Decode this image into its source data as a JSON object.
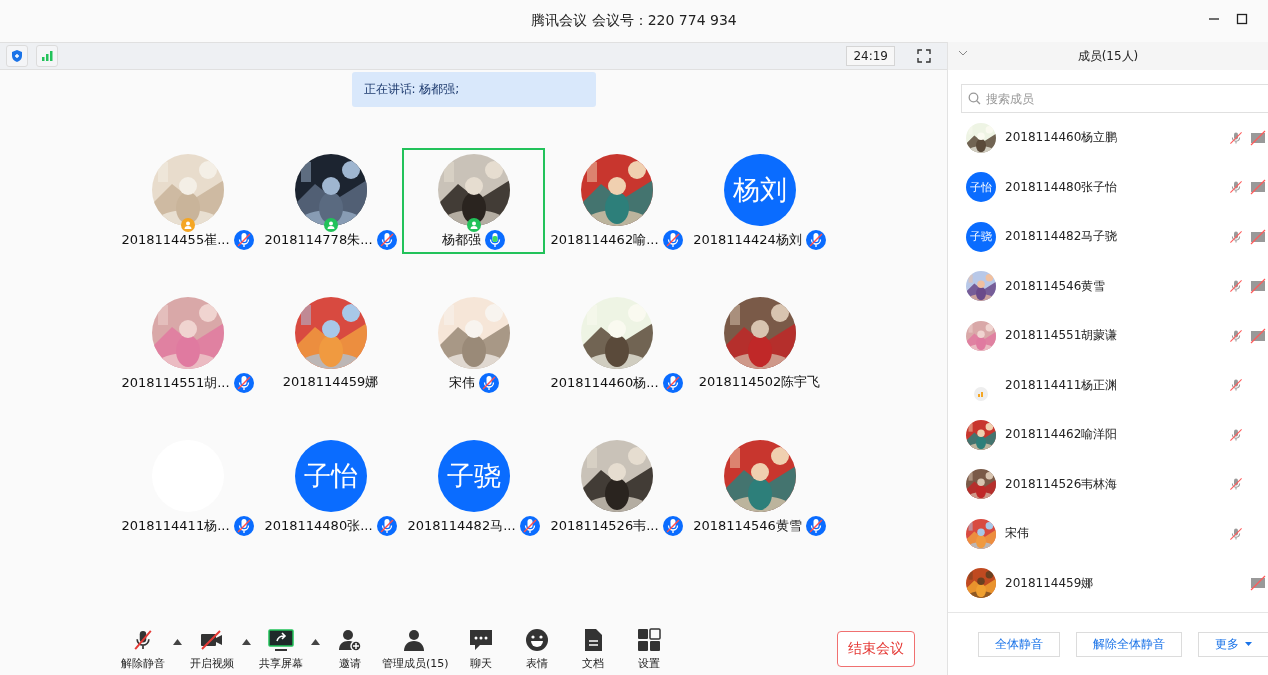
{
  "window": {
    "title": "腾讯会议 会议号：220 774 934"
  },
  "status": {
    "timer": "24:19"
  },
  "speaking_banner": "正在讲话: 杨都强;",
  "participants": [
    {
      "name": "2018114455崔...",
      "kind": "picture",
      "badge": {
        "color": "#f5a623"
      },
      "mic_muted": true,
      "speaking": false,
      "selected": false
    },
    {
      "name": "2018114778朱...",
      "kind": "picture",
      "badge": {
        "color": "#22c25a"
      },
      "mic_muted": true,
      "speaking": false,
      "selected": false
    },
    {
      "name": "杨都强",
      "kind": "picture",
      "badge": {
        "color": "#22c25a"
      },
      "mic_muted": false,
      "speaking": true,
      "selected": true
    },
    {
      "name": "2018114462喻...",
      "kind": "picture",
      "mic_muted": true,
      "speaking": false,
      "selected": false
    },
    {
      "name": "2018114424杨刘",
      "kind": "initials",
      "initials": "杨刘",
      "mic_muted": true,
      "speaking": false,
      "selected": false
    },
    {
      "name": "2018114551胡...",
      "kind": "picture",
      "mic_muted": true,
      "speaking": false,
      "selected": false
    },
    {
      "name": "2018114459娜",
      "kind": "picture",
      "mic_muted": false,
      "speaking": false,
      "selected": false
    },
    {
      "name": "宋伟",
      "kind": "picture",
      "mic_muted": true,
      "speaking": false,
      "selected": false
    },
    {
      "name": "2018114460杨...",
      "kind": "picture",
      "mic_muted": true,
      "speaking": false,
      "selected": false
    },
    {
      "name": "2018114502陈宇飞",
      "kind": "picture",
      "mic_muted": false,
      "speaking": false,
      "selected": false
    },
    {
      "name": "2018114411杨...",
      "kind": "blank",
      "mic_muted": true,
      "speaking": false,
      "selected": false
    },
    {
      "name": "2018114480张...",
      "kind": "initials",
      "initials": "子怡",
      "mic_muted": true,
      "speaking": false,
      "selected": false
    },
    {
      "name": "2018114482马...",
      "kind": "initials",
      "initials": "子骁",
      "mic_muted": true,
      "speaking": false,
      "selected": false
    },
    {
      "name": "2018114526韦...",
      "kind": "picture",
      "mic_muted": true,
      "speaking": false,
      "selected": false
    },
    {
      "name": "2018114546黄雪",
      "kind": "picture",
      "mic_muted": true,
      "speaking": false,
      "selected": false
    }
  ],
  "toolbar": [
    {
      "label": "解除静音",
      "on": false,
      "menu": true
    },
    {
      "label": "开启视频",
      "on": false,
      "menu": true
    },
    {
      "label": "共享屏幕",
      "menu": true
    },
    {
      "label": "邀请",
      "menu": false
    },
    {
      "label": "管理成员(15)",
      "menu": false
    },
    {
      "label": "聊天",
      "menu": false
    },
    {
      "label": "表情",
      "menu": false
    },
    {
      "label": "文档",
      "menu": false
    },
    {
      "label": "设置",
      "menu": false
    }
  ],
  "end_button": "结束会议",
  "members_panel": {
    "title": "成员(15人)",
    "search": {
      "placeholder": "搜索成员"
    },
    "members": [
      {
        "name": "2018114460杨立鹏",
        "kind": "picture",
        "mic_muted": true,
        "camera_off": true
      },
      {
        "name": "2018114480张子怡",
        "kind": "initials",
        "initials": "子怡",
        "mic_muted": true,
        "camera_off": true
      },
      {
        "name": "2018114482马子骁",
        "kind": "initials",
        "initials": "子骁",
        "mic_muted": true,
        "camera_off": true
      },
      {
        "name": "2018114546黄雪",
        "kind": "picture",
        "mic_muted": true,
        "camera_off": true
      },
      {
        "name": "2018114551胡蒙谦",
        "kind": "picture",
        "mic_muted": true,
        "camera_off": true
      },
      {
        "name": "2018114411杨正渊",
        "kind": "blank",
        "mic_muted": true,
        "camera_off": false
      },
      {
        "name": "2018114462喻洋阳",
        "kind": "picture",
        "mic_muted": true,
        "camera_off": false
      },
      {
        "name": "2018114526韦林海",
        "kind": "picture",
        "mic_muted": true,
        "camera_off": false
      },
      {
        "name": "宋伟",
        "kind": "picture",
        "mic_muted": true,
        "camera_off": false
      },
      {
        "name": "2018114459娜",
        "kind": "picture",
        "mic_muted": false,
        "camera_off": true
      }
    ],
    "buttons": [
      {
        "label": "全体静音",
        "menu": false
      },
      {
        "label": "解除全体静音",
        "menu": false
      },
      {
        "label": "更多",
        "menu": true
      }
    ]
  }
}
